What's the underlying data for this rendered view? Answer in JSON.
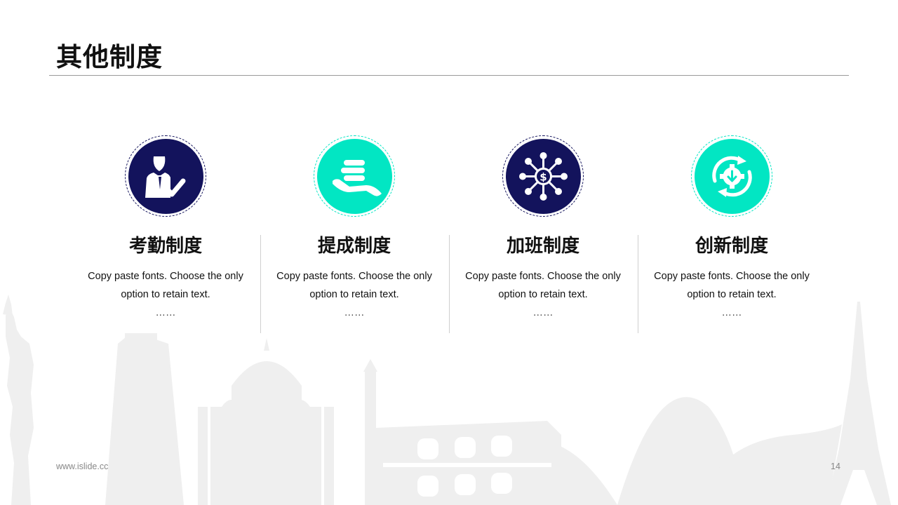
{
  "title": "其他制度",
  "colors": {
    "navy": "#13135c",
    "teal": "#02e6c3",
    "skyline": "#efefef"
  },
  "cards": [
    {
      "title": "考勤制度",
      "line1": "Copy paste fonts. Choose the only",
      "line2": "option to retain text.",
      "dots": "……",
      "icon": "person-check-icon",
      "color": "navy"
    },
    {
      "title": "提成制度",
      "line1": "Copy paste fonts. Choose the only",
      "line2": "option to retain text.",
      "dots": "……",
      "icon": "hand-coins-icon",
      "color": "teal"
    },
    {
      "title": "加班制度",
      "line1": "Copy paste fonts. Choose the only",
      "line2": "option to retain text.",
      "dots": "……",
      "icon": "dollar-network-icon",
      "color": "navy"
    },
    {
      "title": "创新制度",
      "line1": "Copy paste fonts. Choose the only",
      "line2": "option to retain text.",
      "dots": "……",
      "icon": "gear-cycle-icon",
      "color": "teal"
    }
  ],
  "footer": {
    "url": "www.islide.cc",
    "page": "14"
  }
}
